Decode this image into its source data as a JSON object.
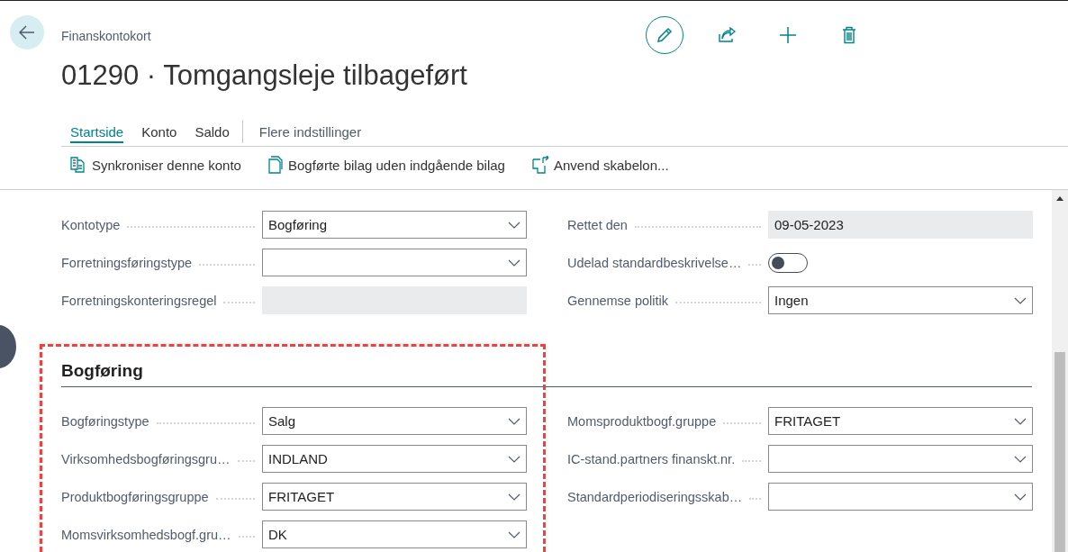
{
  "header": {
    "caption": "Finanskontokort",
    "title": "01290 · Tomgangsleje tilbageført"
  },
  "toolbar": [
    {
      "kind": "edit"
    },
    {
      "kind": "share"
    },
    {
      "kind": "new"
    },
    {
      "kind": "delete"
    }
  ],
  "tabs": [
    {
      "label": "Startside",
      "selected": true,
      "kind": "tab"
    },
    {
      "label": "Konto",
      "selected": false,
      "kind": "tab"
    },
    {
      "label": "Saldo",
      "selected": false,
      "kind": "tab"
    },
    {
      "label": "Flere indstillinger",
      "selected": false,
      "kind": "more"
    }
  ],
  "actions": [
    {
      "label": "Synkroniser denne konto",
      "kind": "sync"
    },
    {
      "label": "Bogførte bilag uden indgående bilag",
      "kind": "document"
    },
    {
      "label": "Anvend skabelon...",
      "kind": "template"
    }
  ],
  "general": {
    "left": [
      {
        "label": "Kontotype",
        "kind": "dropdown",
        "value": "Bogføring"
      },
      {
        "label": "Forretningsføringstype",
        "kind": "dropdown"
      },
      {
        "label": "Forretningskonteringsregel",
        "kind": "readonly"
      }
    ],
    "right": [
      {
        "label": "Rettet den",
        "kind": "readonly",
        "value": "09-05-2023"
      },
      {
        "label": "Udelad standardbeskrivelse…",
        "kind": "toggle",
        "on": false
      },
      {
        "label": "Gennemse politik",
        "kind": "dropdown",
        "value": "Ingen"
      }
    ]
  },
  "sections": [
    {
      "title": "Bogføring",
      "highlighted": true,
      "left": [
        {
          "label": "Bogføringstype",
          "kind": "dropdown",
          "value": "Salg"
        },
        {
          "label": "Virksomhedsbogføringsgru…",
          "kind": "dropdown",
          "value": "INDLAND"
        },
        {
          "label": "Produktbogføringsgruppe",
          "kind": "dropdown",
          "value": "FRITAGET"
        },
        {
          "label": "Momsvirksomhedsbogf.gru…",
          "kind": "dropdown",
          "value": "DK"
        }
      ],
      "right": [
        {
          "label": "Momsproduktbogf.gruppe",
          "kind": "dropdown",
          "value": "FRITAGET"
        },
        {
          "label": "IC-stand.partners finanskt.nr.",
          "kind": "dropdown"
        },
        {
          "label": "Standardperiodiseringsskab…",
          "kind": "dropdown"
        }
      ]
    }
  ]
}
